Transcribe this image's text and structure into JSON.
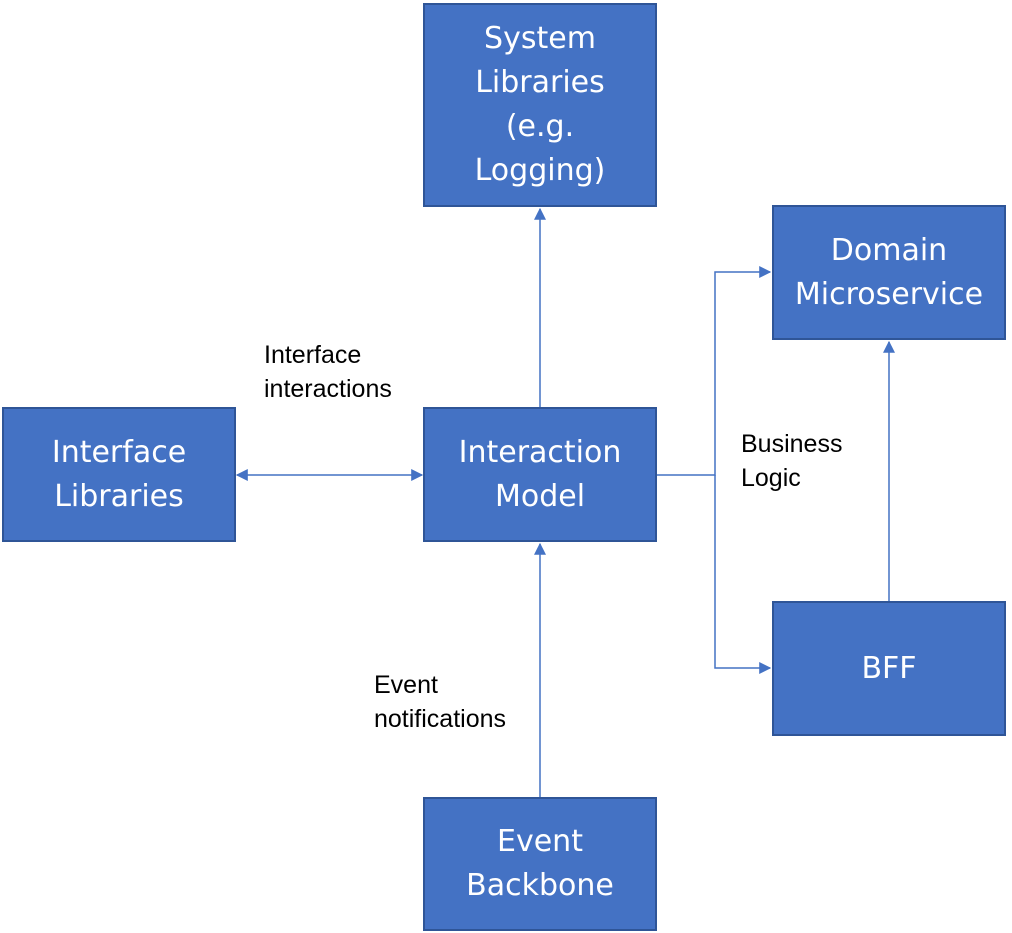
{
  "colors": {
    "box_fill": "#4472c4",
    "box_border": "#2f5597",
    "connector": "#4472c4",
    "box_text": "#ffffff",
    "label_text": "#000000"
  },
  "nodes": {
    "system_libraries": "System\nLibraries\n(e.g.\nLogging)",
    "domain_microservice": "Domain\nMicroservice",
    "interface_libraries": "Interface\nLibraries",
    "interaction_model": "Interaction\nModel",
    "bff": "BFF",
    "event_backbone": "Event\nBackbone"
  },
  "edge_labels": {
    "interface_interactions": "Interface\ninteractions",
    "business_logic": "Business\nLogic",
    "event_notifications": "Event\nnotifications"
  },
  "edges": [
    {
      "from": "interaction_model",
      "to": "system_libraries",
      "direction": "forward"
    },
    {
      "from": "interaction_model",
      "to": "interface_libraries",
      "direction": "bidirectional",
      "label": "interface_interactions"
    },
    {
      "from": "interaction_model",
      "to": "domain_microservice",
      "direction": "forward",
      "label": "business_logic"
    },
    {
      "from": "interaction_model",
      "to": "bff",
      "direction": "forward",
      "label": "business_logic"
    },
    {
      "from": "bff",
      "to": "domain_microservice",
      "direction": "forward"
    },
    {
      "from": "event_backbone",
      "to": "interaction_model",
      "direction": "forward",
      "label": "event_notifications"
    }
  ]
}
